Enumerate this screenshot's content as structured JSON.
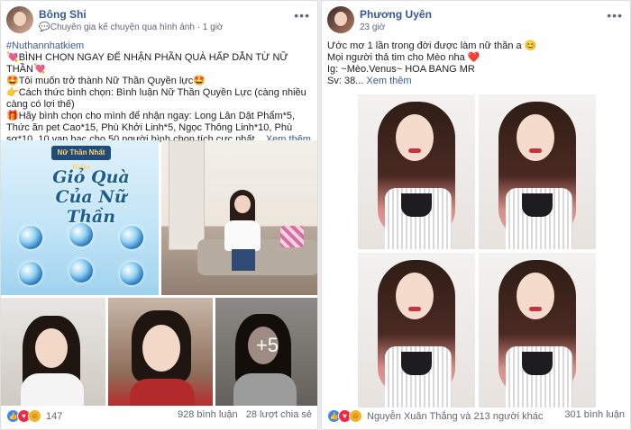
{
  "left_post": {
    "author": "Bông Shi",
    "badge_text": "Chuyên gia kế chuyện qua hình ảnh",
    "time": "1 giờ",
    "lines": [
      {
        "hashtag": "#Nuthannhatkiem"
      },
      {
        "text": "💘BÌNH CHỌN NGAY ĐỂ NHẬN PHẦN QUÀ HẤP DẪN TỪ NỮ THẦN💘"
      },
      {
        "text": "🤩Tôi muốn trở thành Nữ Thần Quyền lực🤩"
      },
      {
        "text": "👉Cách thức bình chọn: Bình luận Nữ Thần Quyền Lực (càng nhiều càng có lợi thế)"
      },
      {
        "text": "🎁Hãy bình chọn cho mình để nhận ngay: Long Lân Dật Phẩm*5, Thức ăn pet Cao*15, Phù Khởi Linh*5, Ngọc Thông Linh*10, Phù sơ*10, 10 vạn bạc cho 50 người bình chọn tích cực nhất..."
      }
    ],
    "see_more": "Xem thêm",
    "promo": {
      "logo": "Nữ Thần Nhất Kiếm",
      "title": "Giỏ Quà Của Nữ Thần"
    },
    "more_photos": "+5",
    "reaction_count": "147",
    "comments": "928 bình luận",
    "shares": "28 lượt chia sẻ"
  },
  "right_post": {
    "author": "Phương Uyên",
    "time": "23 giờ",
    "lines": [
      {
        "text": "Ước mơ 1 lần trong đời được làm nữ thần a 😊"
      },
      {
        "text": "Mọi người thả tim cho Mèo nha ❤️"
      },
      {
        "text": "Ig: ~Mèo.Venus~ HOA BANG MR"
      },
      {
        "text": "Sv: 38..."
      }
    ],
    "see_more": "Xem thêm",
    "reaction_text": "Nguyễn Xuân Thắng và 213 người khác",
    "comments": "301 bình luận"
  },
  "icons": {
    "like": "like-icon",
    "love": "love-icon",
    "haha": "haha-icon",
    "more": "more-icon"
  },
  "colors": {
    "link": "#385898",
    "like": "#3b87f5",
    "love": "#f0284a",
    "haha": "#f7b125"
  }
}
